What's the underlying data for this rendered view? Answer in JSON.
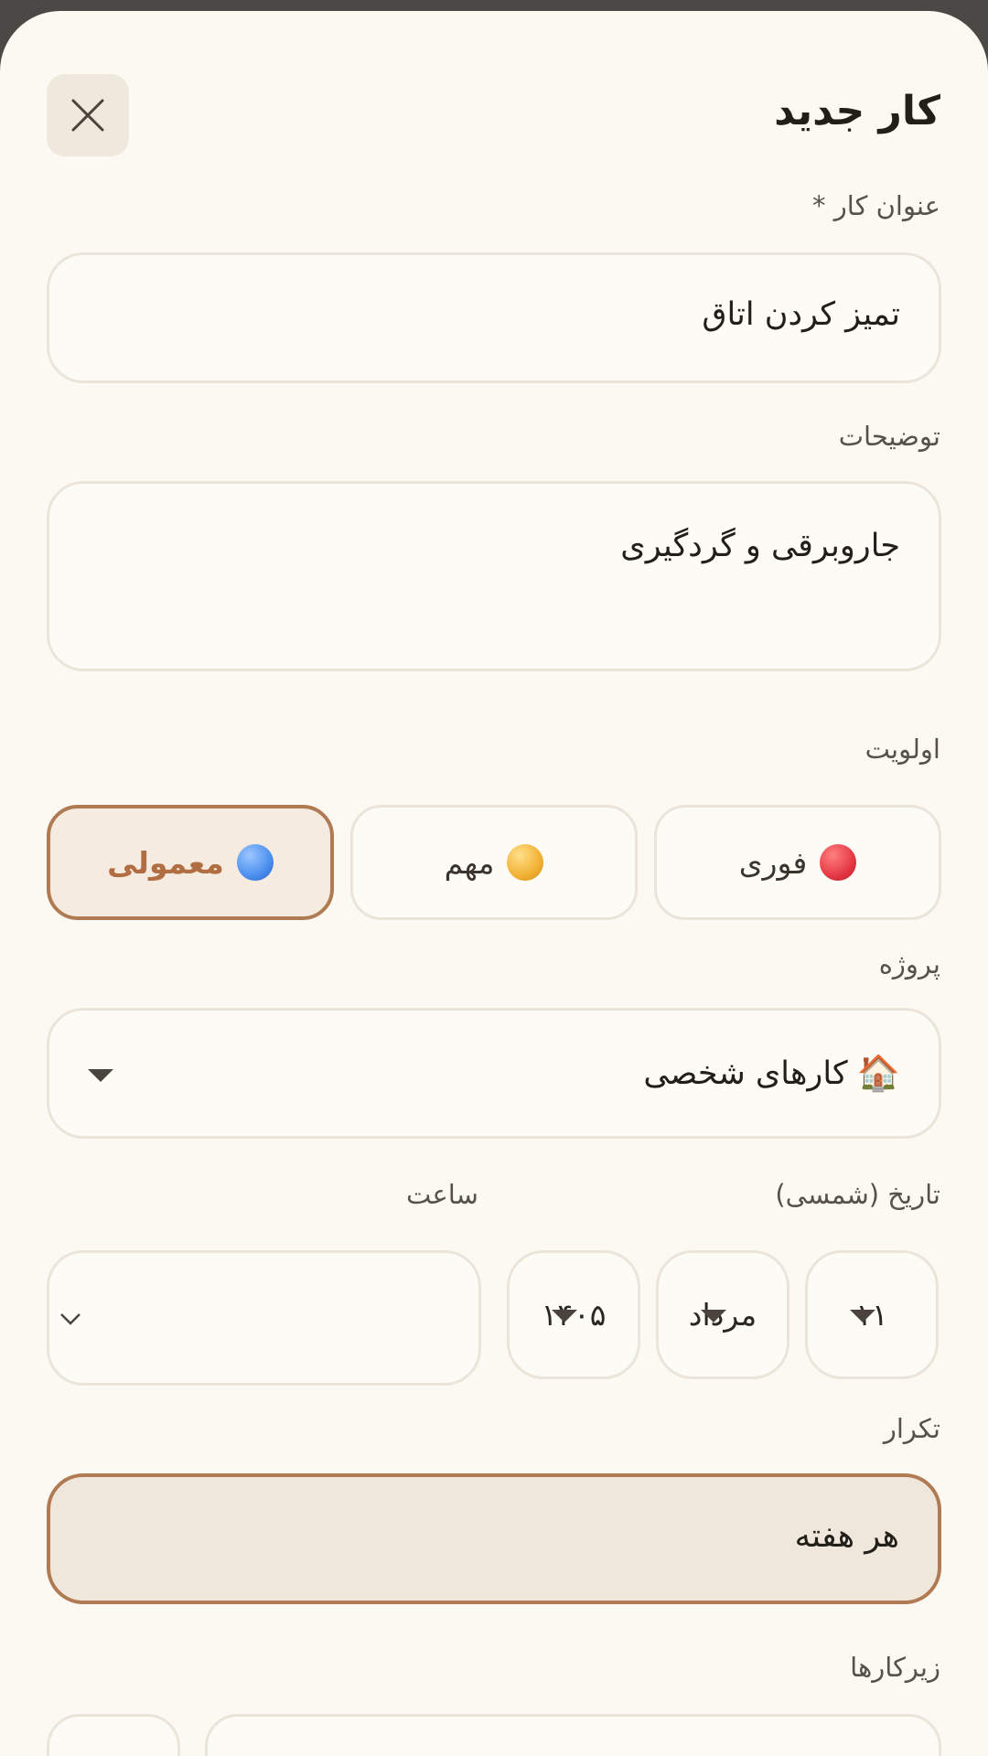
{
  "header": {
    "title": "کار جدید",
    "close_icon": "close-icon"
  },
  "task_title": {
    "label": "عنوان کار *",
    "value": "تمیز کردن اتاق"
  },
  "description": {
    "label": "توضیحات",
    "value": "جاروبرقی و گردگیری"
  },
  "priority": {
    "label": "اولویت",
    "options": [
      {
        "label": "فوری",
        "color": "#e53945",
        "selected": false
      },
      {
        "label": "مهم",
        "color": "#f2b134",
        "selected": false
      },
      {
        "label": "معمولی",
        "color": "#4a8fee",
        "selected": true
      }
    ]
  },
  "project": {
    "label": "پروژه",
    "icon": "🏠",
    "value": "کارهای شخصی"
  },
  "date": {
    "label": "تاریخ (شمسی)",
    "day": "۱۱",
    "month": "مرداد",
    "year": "۱۴۰۵"
  },
  "time": {
    "label": "ساعت",
    "value": ""
  },
  "repeat": {
    "label": "تکرار",
    "value": "هر هفته"
  },
  "subtasks": {
    "label": "زیرکارها"
  },
  "colors": {
    "accent": "#b07a52",
    "background": "#fcf9f2",
    "border": "#ebe4d9"
  }
}
